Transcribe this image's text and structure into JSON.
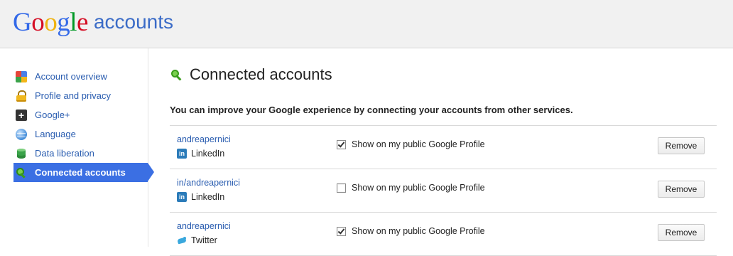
{
  "header": {
    "logo_letters": [
      "G",
      "o",
      "o",
      "g",
      "l",
      "e"
    ],
    "logo_colors": [
      "#3369e8",
      "#d50f25",
      "#eeb211",
      "#3369e8",
      "#009925",
      "#d50f25"
    ],
    "logo_suffix": "accounts"
  },
  "sidebar": {
    "items": [
      {
        "label": "Account overview",
        "icon": "account-overview-icon",
        "active": false
      },
      {
        "label": "Profile and privacy",
        "icon": "lock-icon",
        "active": false
      },
      {
        "label": "Google+",
        "icon": "google-plus-icon",
        "active": false
      },
      {
        "label": "Language",
        "icon": "globe-icon",
        "active": false
      },
      {
        "label": "Data liberation",
        "icon": "database-icon",
        "active": false
      },
      {
        "label": "Connected accounts",
        "icon": "key-icon",
        "active": true
      }
    ],
    "active_color": "#3b6fe3"
  },
  "main": {
    "title": "Connected accounts",
    "title_icon": "key-icon",
    "intro": "You can improve your Google experience by connecting your accounts from other services.",
    "accounts": [
      {
        "name": "andreapernici",
        "service": "LinkedIn",
        "service_icon": "linkedin-icon",
        "show_label": "Show on my public Google Profile",
        "checked": true,
        "remove_label": "Remove"
      },
      {
        "name": "in/andreapernici",
        "service": "LinkedIn",
        "service_icon": "linkedin-icon",
        "show_label": "Show on my public Google Profile",
        "checked": false,
        "remove_label": "Remove"
      },
      {
        "name": "andreapernici",
        "service": "Twitter",
        "service_icon": "twitter-icon",
        "show_label": "Show on my public Google Profile",
        "checked": true,
        "remove_label": "Remove"
      }
    ]
  }
}
